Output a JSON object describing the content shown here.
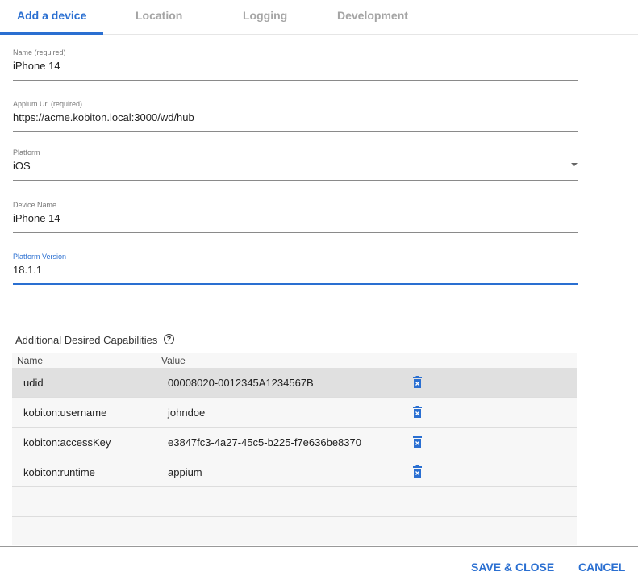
{
  "tabs": [
    "Add a device",
    "Location",
    "Logging",
    "Development"
  ],
  "fields": [
    {
      "label": "Name (required)",
      "value": "iPhone 14"
    },
    {
      "label": "Appium Url (required)",
      "value": "https://acme.kobiton.local:3000/wd/hub"
    },
    {
      "label": "Platform",
      "value": "iOS"
    },
    {
      "label": "Device Name",
      "value": "iPhone 14"
    },
    {
      "label": "Platform Version",
      "value": "18.1.1"
    }
  ],
  "capabilities": {
    "title": "Additional Desired Capabilities",
    "help": "?",
    "headers": {
      "name": "Name",
      "value": "Value"
    },
    "rows": [
      {
        "name": "udid",
        "value": "00008020-0012345A1234567B"
      },
      {
        "name": "kobiton:username",
        "value": "johndoe"
      },
      {
        "name": "kobiton:accessKey",
        "value": "e3847fc3-4a27-45c5-b225-f7e636be8370"
      },
      {
        "name": "kobiton:runtime",
        "value": "appium"
      }
    ]
  },
  "footer": {
    "save": "SAVE & CLOSE",
    "cancel": "CANCEL"
  }
}
